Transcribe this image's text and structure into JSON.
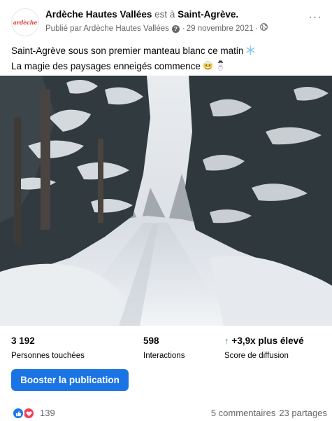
{
  "post": {
    "page_name": "Ardèche Hautes Vallées",
    "location_connector": "est à",
    "location": "Saint-Agrève.",
    "published_by": "Publié par Ardèche Hautes Vallées",
    "meta_separator": "·",
    "date": "29 novembre 2021",
    "avatar_text": "ardèche",
    "more_label": "···",
    "caption_line1": "Saint-Agrève sous son premier manteau blanc ce matin",
    "caption_line2": "La magie des paysages enneigés commence"
  },
  "stats": [
    {
      "value": "3 192",
      "label": "Personnes touchées"
    },
    {
      "value": "598",
      "label": "Interactions"
    },
    {
      "value": "+3,9x plus élevé",
      "label": "Score de diffusion"
    }
  ],
  "boost_button": "Booster la publication",
  "reactions": {
    "count": "139",
    "comments": "5 commentaires",
    "shares": "23 partages"
  },
  "colors": {
    "accent": "#1b74e4",
    "muted": "#65676b",
    "up": "#31a24c",
    "like": "#1877f2",
    "love": "#f33e58"
  },
  "icons": [
    "help-icon",
    "globe-icon",
    "snowflake-icon",
    "cold-face-icon",
    "snowman-icon",
    "up-arrow-icon",
    "like-icon",
    "love-icon"
  ]
}
